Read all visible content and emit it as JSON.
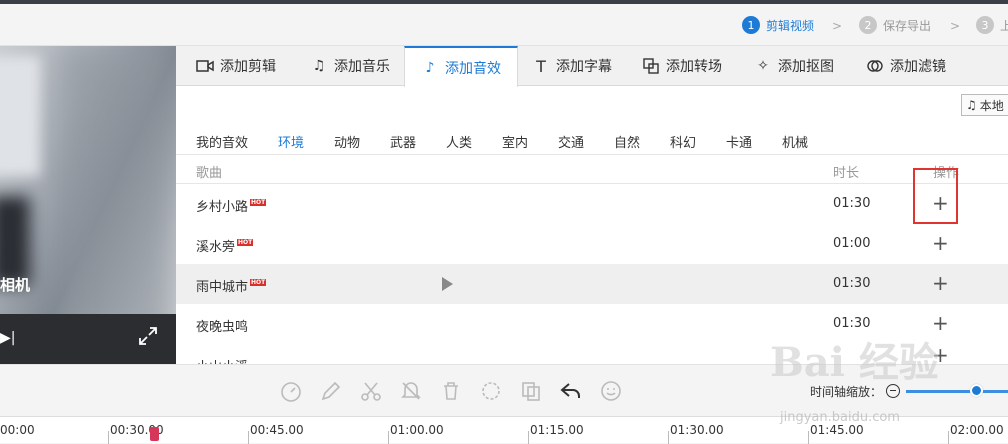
{
  "steps": [
    {
      "num": "1",
      "label": "剪辑视频"
    },
    {
      "num": "2",
      "label": "保存导出"
    },
    {
      "num": "3",
      "label": "上"
    }
  ],
  "preview": {
    "caption": "相机"
  },
  "tabs": [
    {
      "label": "添加剪辑",
      "icon": "video-icon"
    },
    {
      "label": "添加音乐",
      "icon": "music-icon"
    },
    {
      "label": "添加音效",
      "icon": "sound-effect-icon"
    },
    {
      "label": "添加字幕",
      "icon": "text-icon"
    },
    {
      "label": "添加转场",
      "icon": "transition-icon"
    },
    {
      "label": "添加抠图",
      "icon": "cutout-icon"
    },
    {
      "label": "添加滤镜",
      "icon": "filter-icon"
    }
  ],
  "local_button": "本地",
  "categories": [
    "我的音效",
    "环境",
    "动物",
    "武器",
    "人类",
    "室内",
    "交通",
    "自然",
    "科幻",
    "卡通",
    "机械"
  ],
  "active_category": "环境",
  "table": {
    "headers": {
      "song": "歌曲",
      "duration": "时长",
      "action": "操作"
    },
    "rows": [
      {
        "name": "乡村小路",
        "hot": "HOT",
        "duration": "01:30",
        "action": "+"
      },
      {
        "name": "溪水旁",
        "hot": "HOT",
        "duration": "01:00",
        "action": "+"
      },
      {
        "name": "雨中城市",
        "hot": "HOT",
        "duration": "01:30",
        "action": "+"
      },
      {
        "name": "夜晚虫鸣",
        "hot": "",
        "duration": "01:30",
        "action": "+"
      },
      {
        "name": "小山小溪",
        "hot": "",
        "duration": "",
        "action": "+"
      }
    ]
  },
  "zoom": {
    "label": "时间轴缩放："
  },
  "timeline": {
    "ticks": [
      "00:00",
      "00:30.00",
      "00:45.00",
      "01:00.00",
      "01:15.00",
      "01:30.00",
      "01:45.00",
      "02:00.00"
    ]
  },
  "watermark": {
    "main": "Bai 经验",
    "sub": "jingyan.baidu.com"
  },
  "colors": {
    "accent": "#1d7bd6",
    "highlight_box": "#e0342f",
    "hot_badge": "#d9302c"
  }
}
